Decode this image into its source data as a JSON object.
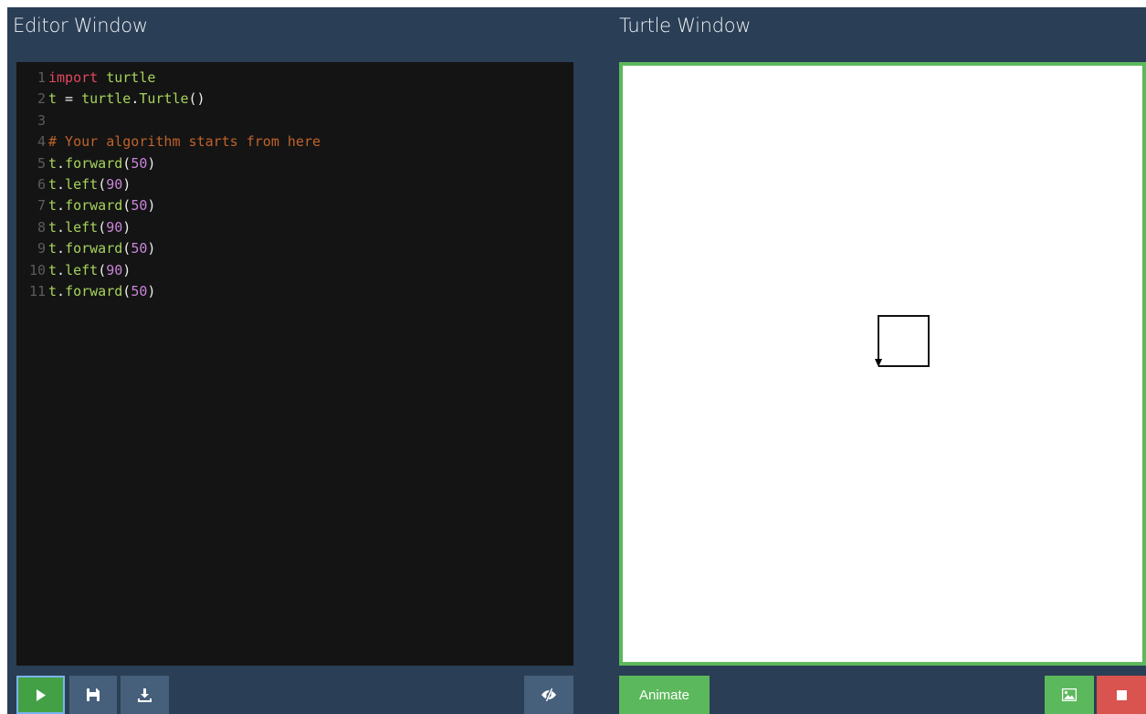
{
  "editor": {
    "title": "Editor Window",
    "lines": [
      {
        "num": "1",
        "tokens": [
          {
            "t": "import",
            "c": "keyword"
          },
          {
            "t": " ",
            "c": "plain"
          },
          {
            "t": "turtle",
            "c": "name"
          }
        ]
      },
      {
        "num": "2",
        "tokens": [
          {
            "t": "t",
            "c": "name"
          },
          {
            "t": " = ",
            "c": "plain"
          },
          {
            "t": "turtle",
            "c": "name"
          },
          {
            "t": ".",
            "c": "plain"
          },
          {
            "t": "Turtle",
            "c": "name"
          },
          {
            "t": "()",
            "c": "plain"
          }
        ]
      },
      {
        "num": "3",
        "tokens": []
      },
      {
        "num": "4",
        "tokens": [
          {
            "t": "# Your algorithm starts from here",
            "c": "comment"
          }
        ]
      },
      {
        "num": "5",
        "tokens": [
          {
            "t": "t",
            "c": "name"
          },
          {
            "t": ".",
            "c": "plain"
          },
          {
            "t": "forward",
            "c": "name"
          },
          {
            "t": "(",
            "c": "plain"
          },
          {
            "t": "50",
            "c": "number"
          },
          {
            "t": ")",
            "c": "plain"
          }
        ]
      },
      {
        "num": "6",
        "tokens": [
          {
            "t": "t",
            "c": "name"
          },
          {
            "t": ".",
            "c": "plain"
          },
          {
            "t": "left",
            "c": "name"
          },
          {
            "t": "(",
            "c": "plain"
          },
          {
            "t": "90",
            "c": "number"
          },
          {
            "t": ")",
            "c": "plain"
          }
        ]
      },
      {
        "num": "7",
        "tokens": [
          {
            "t": "t",
            "c": "name"
          },
          {
            "t": ".",
            "c": "plain"
          },
          {
            "t": "forward",
            "c": "name"
          },
          {
            "t": "(",
            "c": "plain"
          },
          {
            "t": "50",
            "c": "number"
          },
          {
            "t": ")",
            "c": "plain"
          }
        ]
      },
      {
        "num": "8",
        "tokens": [
          {
            "t": "t",
            "c": "name"
          },
          {
            "t": ".",
            "c": "plain"
          },
          {
            "t": "left",
            "c": "name"
          },
          {
            "t": "(",
            "c": "plain"
          },
          {
            "t": "90",
            "c": "number"
          },
          {
            "t": ")",
            "c": "plain"
          }
        ]
      },
      {
        "num": "9",
        "tokens": [
          {
            "t": "t",
            "c": "name"
          },
          {
            "t": ".",
            "c": "plain"
          },
          {
            "t": "forward",
            "c": "name"
          },
          {
            "t": "(",
            "c": "plain"
          },
          {
            "t": "50",
            "c": "number"
          },
          {
            "t": ")",
            "c": "plain"
          }
        ]
      },
      {
        "num": "10",
        "tokens": [
          {
            "t": "t",
            "c": "name"
          },
          {
            "t": ".",
            "c": "plain"
          },
          {
            "t": "left",
            "c": "name"
          },
          {
            "t": "(",
            "c": "plain"
          },
          {
            "t": "90",
            "c": "number"
          },
          {
            "t": ")",
            "c": "plain"
          }
        ]
      },
      {
        "num": "11",
        "tokens": [
          {
            "t": "t",
            "c": "name"
          },
          {
            "t": ".",
            "c": "plain"
          },
          {
            "t": "forward",
            "c": "name"
          },
          {
            "t": "(",
            "c": "plain"
          },
          {
            "t": "50",
            "c": "number"
          },
          {
            "t": ")",
            "c": "plain"
          }
        ]
      }
    ],
    "toolbar": {
      "run_icon": "play-icon",
      "save_icon": "floppy-disk-icon",
      "download_icon": "download-icon",
      "toggle_icon": "eye-slash-icon"
    }
  },
  "turtle": {
    "title": "Turtle Window",
    "animate_label": "Animate",
    "image_icon": "image-icon",
    "stop_icon": "stop-icon"
  },
  "colors": {
    "background": "#2a3e55",
    "editor_bg": "#141414",
    "toolbar_button": "#46607b",
    "success": "#5cb85c",
    "danger": "#d9534f"
  }
}
